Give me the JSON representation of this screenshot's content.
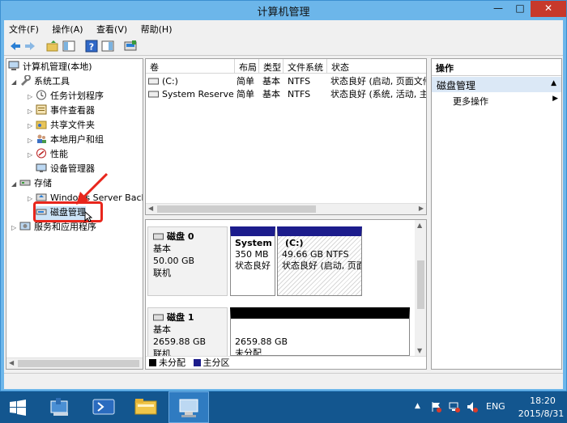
{
  "window": {
    "title": "计算机管理"
  },
  "menu": [
    "文件(F)",
    "操作(A)",
    "查看(V)",
    "帮助(H)"
  ],
  "tree": [
    {
      "label": "计算机管理(本地)",
      "level": 0
    },
    {
      "label": "系统工具",
      "level": 1
    },
    {
      "label": "任务计划程序",
      "level": 2
    },
    {
      "label": "事件查看器",
      "level": 2
    },
    {
      "label": "共享文件夹",
      "level": 2
    },
    {
      "label": "本地用户和组",
      "level": 2
    },
    {
      "label": "性能",
      "level": 2
    },
    {
      "label": "设备管理器",
      "level": 2
    },
    {
      "label": "存储",
      "level": 1
    },
    {
      "label": "Windows Server Back",
      "level": 2
    },
    {
      "label": "磁盘管理",
      "level": 2,
      "selected": true
    },
    {
      "label": "服务和应用程序",
      "level": 1
    }
  ],
  "volumes": {
    "columns": [
      "卷",
      "布局",
      "类型",
      "文件系统",
      "状态"
    ],
    "rows": [
      [
        "(C:)",
        "简单",
        "基本",
        "NTFS",
        "状态良好 (启动, 页面文件"
      ],
      [
        "System Reserved",
        "简单",
        "基本",
        "NTFS",
        "状态良好 (系统, 活动, 主分"
      ]
    ]
  },
  "disks": [
    {
      "name": "磁盘 0",
      "type": "基本",
      "size": "50.00 GB",
      "status": "联机",
      "partitions": [
        {
          "name": "System",
          "size": "350 MB",
          "status": "状态良好",
          "selected": false
        },
        {
          "name": "(C:)",
          "size": "49.66 GB NTFS",
          "status": "状态良好 (启动, 页面",
          "selected": true
        }
      ]
    },
    {
      "name": "磁盘 1",
      "type": "基本",
      "size": "2659.88 GB",
      "status": "联机",
      "partitions": [
        {
          "name": "",
          "size": "2659.88 GB",
          "status": "未分配"
        }
      ]
    }
  ],
  "legend": [
    {
      "label": "未分配",
      "color": "#000000"
    },
    {
      "label": "主分区",
      "color": "#1c1c8c"
    }
  ],
  "actions": {
    "header": "操作",
    "section": "磁盘管理",
    "item": "更多操作"
  },
  "taskbar": {
    "lang": "ENG",
    "time": "18:20",
    "date": "2015/8/31"
  },
  "colors": {
    "primary_partition": "#1c1c8c",
    "unallocated": "#000000",
    "highlight": "#e8261c"
  }
}
